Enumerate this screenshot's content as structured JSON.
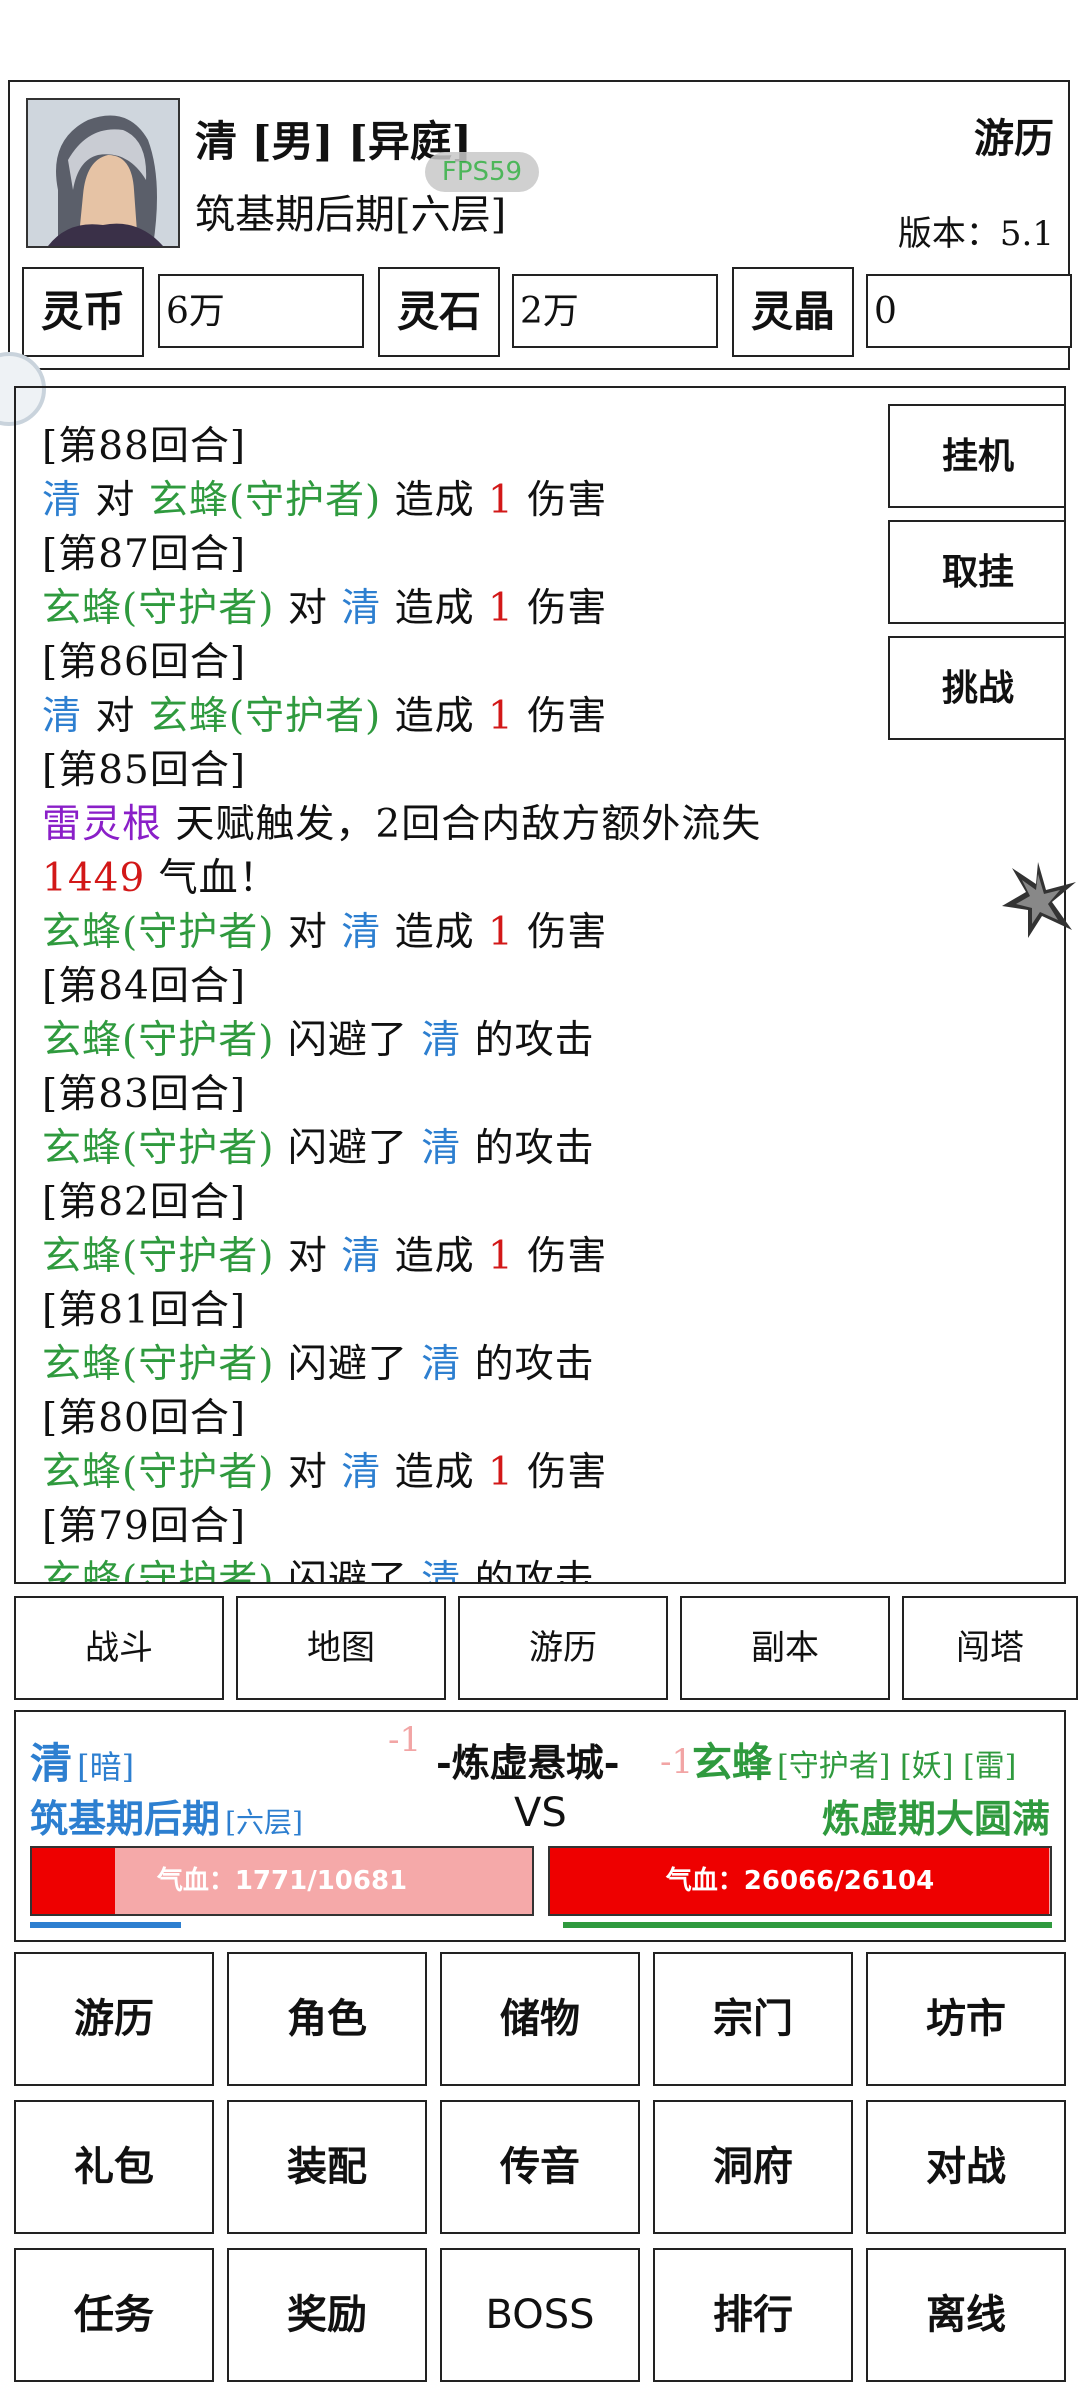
{
  "header": {
    "player_name": "清 [男] [异庭]",
    "realm": "筑基期后期[六层]",
    "fps": "FPS59",
    "mode": "游历",
    "version": "版本：5.1",
    "currencies": [
      {
        "label": "灵币",
        "value": "6万"
      },
      {
        "label": "灵石",
        "value": "2万"
      },
      {
        "label": "灵晶",
        "value": "0"
      }
    ]
  },
  "log": {
    "lines": [
      [
        {
          "t": "[第88回合]",
          "c": "black"
        }
      ],
      [
        {
          "t": "清",
          "c": "blue"
        },
        {
          "t": " 对 ",
          "c": "black"
        },
        {
          "t": "玄蜂(守护者)",
          "c": "green"
        },
        {
          "t": " 造成 ",
          "c": "black"
        },
        {
          "t": "1",
          "c": "red"
        },
        {
          "t": " 伤害",
          "c": "black"
        }
      ],
      [
        {
          "t": "[第87回合]",
          "c": "black"
        }
      ],
      [
        {
          "t": "玄蜂(守护者)",
          "c": "green"
        },
        {
          "t": " 对 ",
          "c": "black"
        },
        {
          "t": "清",
          "c": "blue"
        },
        {
          "t": " 造成 ",
          "c": "black"
        },
        {
          "t": "1",
          "c": "red"
        },
        {
          "t": " 伤害",
          "c": "black"
        }
      ],
      [
        {
          "t": "[第86回合]",
          "c": "black"
        }
      ],
      [
        {
          "t": "清",
          "c": "blue"
        },
        {
          "t": " 对 ",
          "c": "black"
        },
        {
          "t": "玄蜂(守护者)",
          "c": "green"
        },
        {
          "t": " 造成 ",
          "c": "black"
        },
        {
          "t": "1",
          "c": "red"
        },
        {
          "t": " 伤害",
          "c": "black"
        }
      ],
      [
        {
          "t": "[第85回合]",
          "c": "black"
        }
      ],
      [
        {
          "t": "雷灵根",
          "c": "purple"
        },
        {
          "t": " 天赋触发，2回合内敌方额外流失",
          "c": "black"
        }
      ],
      [
        {
          "t": "1449",
          "c": "red"
        },
        {
          "t": " 气血！",
          "c": "black"
        }
      ],
      [
        {
          "t": "玄蜂(守护者)",
          "c": "green"
        },
        {
          "t": " 对 ",
          "c": "black"
        },
        {
          "t": "清",
          "c": "blue"
        },
        {
          "t": " 造成 ",
          "c": "black"
        },
        {
          "t": "1",
          "c": "red"
        },
        {
          "t": " 伤害",
          "c": "black"
        }
      ],
      [
        {
          "t": "[第84回合]",
          "c": "black"
        }
      ],
      [
        {
          "t": "玄蜂(守护者)",
          "c": "green"
        },
        {
          "t": " 闪避了 ",
          "c": "black"
        },
        {
          "t": "清",
          "c": "blue"
        },
        {
          "t": " 的攻击",
          "c": "black"
        }
      ],
      [
        {
          "t": "[第83回合]",
          "c": "black"
        }
      ],
      [
        {
          "t": "玄蜂(守护者)",
          "c": "green"
        },
        {
          "t": " 闪避了 ",
          "c": "black"
        },
        {
          "t": "清",
          "c": "blue"
        },
        {
          "t": " 的攻击",
          "c": "black"
        }
      ],
      [
        {
          "t": "[第82回合]",
          "c": "black"
        }
      ],
      [
        {
          "t": "玄蜂(守护者)",
          "c": "green"
        },
        {
          "t": " 对 ",
          "c": "black"
        },
        {
          "t": "清",
          "c": "blue"
        },
        {
          "t": " 造成 ",
          "c": "black"
        },
        {
          "t": "1",
          "c": "red"
        },
        {
          "t": " 伤害",
          "c": "black"
        }
      ],
      [
        {
          "t": "[第81回合]",
          "c": "black"
        }
      ],
      [
        {
          "t": "玄蜂(守护者)",
          "c": "green"
        },
        {
          "t": " 闪避了 ",
          "c": "black"
        },
        {
          "t": "清",
          "c": "blue"
        },
        {
          "t": " 的攻击",
          "c": "black"
        }
      ],
      [
        {
          "t": "[第80回合]",
          "c": "black"
        }
      ],
      [
        {
          "t": "玄蜂(守护者)",
          "c": "green"
        },
        {
          "t": " 对 ",
          "c": "black"
        },
        {
          "t": "清",
          "c": "blue"
        },
        {
          "t": " 造成 ",
          "c": "black"
        },
        {
          "t": "1",
          "c": "red"
        },
        {
          "t": " 伤害",
          "c": "black"
        }
      ],
      [
        {
          "t": "[第79回合]",
          "c": "black"
        }
      ],
      [
        {
          "t": "玄蜂(守护者)",
          "c": "green"
        },
        {
          "t": " 闪避了 ",
          "c": "black"
        },
        {
          "t": "清",
          "c": "blue"
        },
        {
          "t": " 的攻击",
          "c": "black"
        }
      ]
    ],
    "side_buttons": [
      "挂机",
      "取挂",
      "挑战"
    ]
  },
  "nav_tabs": [
    "战斗",
    "地图",
    "游历",
    "副本",
    "闯塔"
  ],
  "battle": {
    "player_name": "清",
    "player_tag": "[暗]",
    "location": "-炼虚悬城-",
    "enemy_name": "玄蜂",
    "enemy_tags": "[守护者] [妖] [雷]",
    "player_realm": "筑基期后期",
    "player_layer": "[六层]",
    "vs": "VS",
    "enemy_realm": "炼虚期大圆满",
    "damage_left": "-1",
    "damage_right": "-1",
    "player_hp": {
      "label": "气血：1771/10681",
      "current": 1771,
      "max": 10681
    },
    "enemy_hp": {
      "label": "气血：26066/26104",
      "current": 26066,
      "max": 26104
    },
    "player_progress": 0.3,
    "enemy_progress": 0.97
  },
  "grid_menu": [
    [
      "游历",
      "角色",
      "储物",
      "宗门",
      "坊市"
    ],
    [
      "礼包",
      "装配",
      "传音",
      "洞府",
      "对战"
    ],
    [
      "任务",
      "奖励",
      "BOSS",
      "排行",
      "离线"
    ]
  ],
  "colors": {
    "blue": "#2d7fd0",
    "green": "#2f9a3e",
    "red": "#d21818",
    "purple": "#8a1fc8",
    "black": "#111111"
  }
}
